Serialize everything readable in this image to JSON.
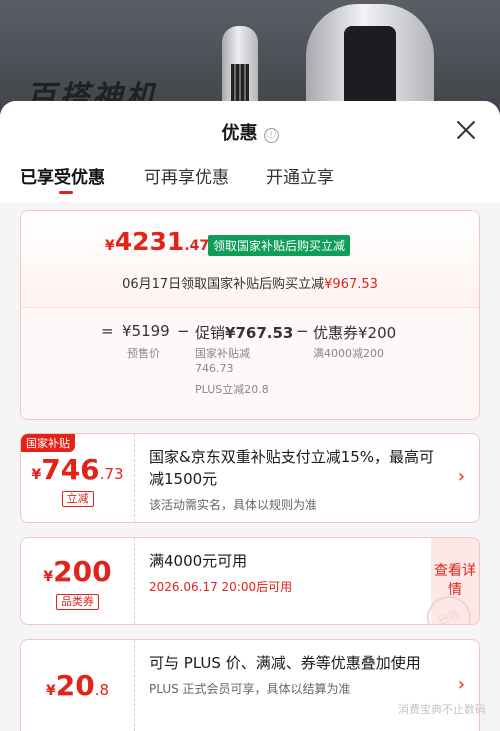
{
  "background": {
    "banner_text": "百搭神机"
  },
  "header": {
    "title": "优惠",
    "info_icon": "ⓘ"
  },
  "tabs": [
    {
      "label": "已享受优惠",
      "active": true
    },
    {
      "label": "可再享优惠",
      "active": false
    },
    {
      "label": "开通立享",
      "active": false
    }
  ],
  "summary": {
    "currency": "¥",
    "final_int": "4231",
    "final_dec": ".47",
    "green_tag": "领取国家补贴后购买立减",
    "line_prefix": "06月17日领取国家补贴后购买立减",
    "line_amount": "¥967.53",
    "eq_sign": "=",
    "presale_price": "¥5199",
    "presale_label": "预售价",
    "minus1": "−",
    "promo_label": "促销",
    "promo_amount": "¥767.53",
    "promo_sub1": "国家补贴减",
    "promo_sub1_val": "746.73",
    "promo_sub2": "PLUS立减20.8",
    "minus2": "−",
    "coupon_label": "优惠券",
    "coupon_amount": "¥200",
    "coupon_sub": "满4000减200"
  },
  "coupons": [
    {
      "corner": "国家补贴",
      "currency": "¥",
      "int": "746",
      "dec": ".73",
      "tag": "立减",
      "title": "国家&京东双重补贴支付立减15%，最高可减1500元",
      "desc": "该活动需实名，具体以规则为准",
      "chevron": "›"
    },
    {
      "currency": "¥",
      "int": "200",
      "dec": "",
      "tag": "品类券",
      "title": "满4000元可用",
      "desc": "2026.06.17 20:00后可用",
      "view_label": "查看详情",
      "stamp": "已领"
    },
    {
      "currency": "¥",
      "int": "20",
      "dec": ".8",
      "title": "可与 PLUS 价、满减、券等优惠叠加使用",
      "desc": "PLUS 正式会员可享，具体以结算为准",
      "chevron": "›"
    }
  ],
  "watermark": "消费宝典不止数码",
  "colors": {
    "accent": "#e2231a",
    "green": "#0f9d58"
  }
}
